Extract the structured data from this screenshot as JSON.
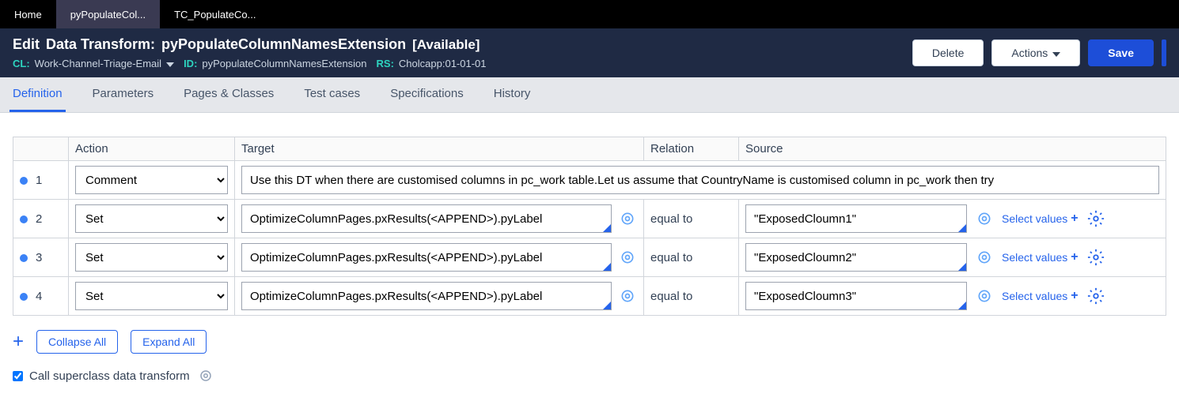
{
  "topbar": {
    "tabs": [
      {
        "label": "Home"
      },
      {
        "label": "pyPopulateCol..."
      },
      {
        "label": "TC_PopulateCo..."
      }
    ],
    "active_index": 1
  },
  "header": {
    "edit_label": "Edit",
    "type_label": "Data Transform:",
    "name": "pyPopulateColumnNamesExtension",
    "status": "[Available]",
    "meta": {
      "cl_label": "CL:",
      "cl_value": "Work-Channel-Triage-Email",
      "id_label": "ID:",
      "id_value": "pyPopulateColumnNamesExtension",
      "rs_label": "RS:",
      "rs_value": "Cholcapp:01-01-01"
    },
    "actions": {
      "delete_label": "Delete",
      "actions_label": "Actions",
      "save_label": "Save"
    }
  },
  "tabs": {
    "items": [
      "Definition",
      "Parameters",
      "Pages & Classes",
      "Test cases",
      "Specifications",
      "History"
    ],
    "active_index": 0
  },
  "grid": {
    "headers": {
      "action": "Action",
      "target": "Target",
      "relation": "Relation",
      "source": "Source"
    },
    "rows": [
      {
        "num": "1",
        "action": "Comment",
        "target": "Use this DT when there are customised columns in pc_work table.Let us assume that CountryName is customised column in pc_work then try",
        "relation": "",
        "source": "",
        "is_comment": true
      },
      {
        "num": "2",
        "action": "Set",
        "target": "OptimizeColumnPages.pxResults(<APPEND>).pyLabel",
        "relation": "equal to",
        "source": "\"ExposedCloumn1\"",
        "is_comment": false
      },
      {
        "num": "3",
        "action": "Set",
        "target": "OptimizeColumnPages.pxResults(<APPEND>).pyLabel",
        "relation": "equal to",
        "source": "\"ExposedCloumn2\"",
        "is_comment": false
      },
      {
        "num": "4",
        "action": "Set",
        "target": "OptimizeColumnPages.pxResults(<APPEND>).pyLabel",
        "relation": "equal to",
        "source": "\"ExposedCloumn3\"",
        "is_comment": false
      }
    ],
    "select_values_label": "Select values"
  },
  "toolbar": {
    "collapse_label": "Collapse All",
    "expand_label": "Expand All"
  },
  "checkbox": {
    "label": "Call superclass data transform",
    "checked": true
  }
}
